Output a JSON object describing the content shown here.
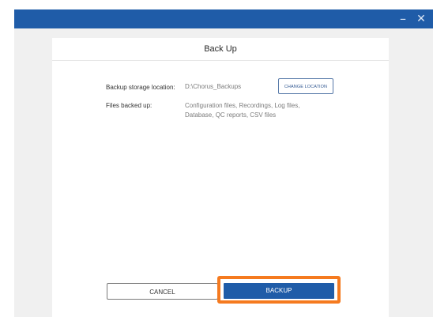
{
  "window": {
    "minimize_icon": "minimize-icon",
    "close_icon": "close-icon",
    "minimize_glyph": "–",
    "close_glyph": "✕"
  },
  "dialog": {
    "title": "Back Up",
    "storage_label": "Backup storage location:",
    "storage_value": "D:\\Chorus_Backups",
    "change_location_label": "CHANGE LOCATION",
    "files_label": "Files backed up:",
    "files_value_line1": "Configuration files, Recordings, Log files,",
    "files_value_line2": "Database, QC reports, CSV files",
    "cancel_label": "CANCEL",
    "backup_label": "BACKUP"
  },
  "colors": {
    "accent": "#1f5ca8",
    "highlight": "#f57a1f"
  }
}
